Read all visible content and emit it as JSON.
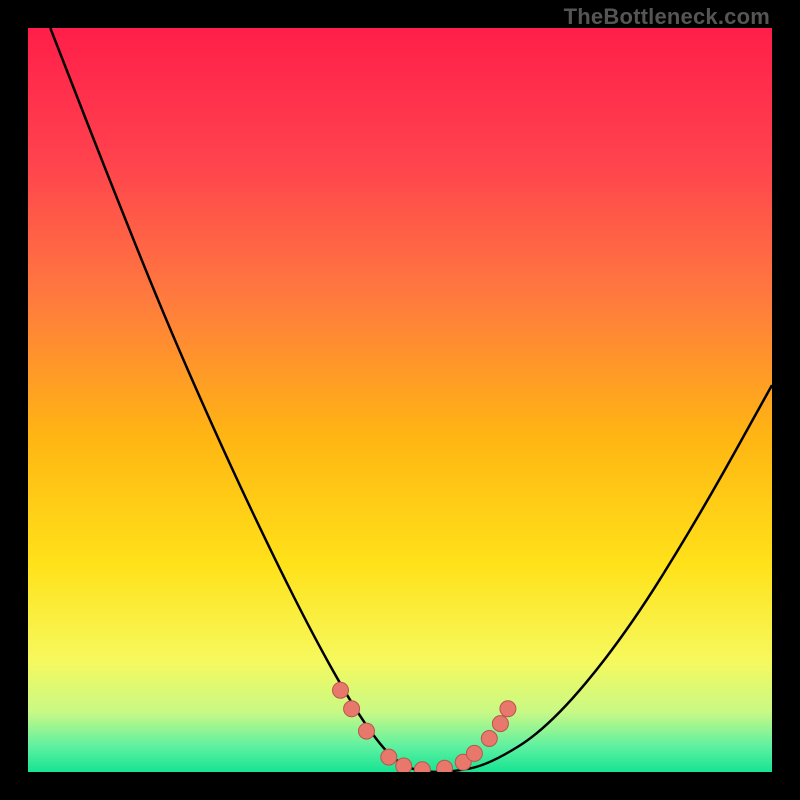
{
  "watermark": "TheBottleneck.com",
  "colors": {
    "frame": "#000000",
    "curve_stroke": "#000000",
    "marker_fill": "#e8786b",
    "marker_stroke": "#b6564d",
    "gradient_stops": [
      {
        "offset": 0.0,
        "color": "#ff1f4a"
      },
      {
        "offset": 0.18,
        "color": "#ff434e"
      },
      {
        "offset": 0.36,
        "color": "#ff7a3f"
      },
      {
        "offset": 0.55,
        "color": "#ffb613"
      },
      {
        "offset": 0.72,
        "color": "#ffe21a"
      },
      {
        "offset": 0.85,
        "color": "#f7f95e"
      },
      {
        "offset": 0.92,
        "color": "#c8f986"
      },
      {
        "offset": 0.965,
        "color": "#60f1a1"
      },
      {
        "offset": 1.0,
        "color": "#16e594"
      }
    ]
  },
  "chart_data": {
    "type": "line",
    "title": "",
    "xlabel": "",
    "ylabel": "",
    "xlim": [
      0,
      100
    ],
    "ylim": [
      0,
      100
    ],
    "grid": false,
    "legend": false,
    "series": [
      {
        "name": "bottleneck-curve",
        "x": [
          3,
          10,
          18,
          25,
          32,
          38,
          43,
          47,
          50,
          53,
          57,
          62,
          70,
          80,
          90,
          100
        ],
        "y": [
          100,
          82,
          62,
          46,
          31,
          19,
          10,
          4,
          1,
          0,
          0,
          1,
          6,
          18,
          34,
          52
        ]
      }
    ],
    "markers": {
      "name": "curve-markers",
      "points": [
        {
          "x": 42.0,
          "y": 11.0
        },
        {
          "x": 43.5,
          "y": 8.5
        },
        {
          "x": 45.5,
          "y": 5.5
        },
        {
          "x": 48.5,
          "y": 2.0
        },
        {
          "x": 50.5,
          "y": 0.8
        },
        {
          "x": 53.0,
          "y": 0.3
        },
        {
          "x": 56.0,
          "y": 0.5
        },
        {
          "x": 58.5,
          "y": 1.3
        },
        {
          "x": 60.0,
          "y": 2.5
        },
        {
          "x": 62.0,
          "y": 4.5
        },
        {
          "x": 63.5,
          "y": 6.5
        },
        {
          "x": 64.5,
          "y": 8.5
        }
      ]
    }
  }
}
